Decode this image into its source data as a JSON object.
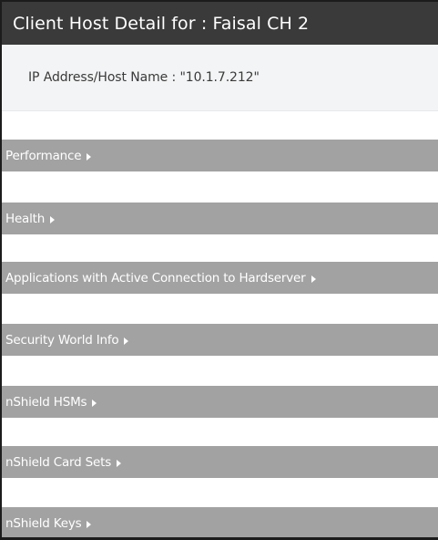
{
  "dialog": {
    "title": "Client Host Detail for : Faisal CH 2"
  },
  "host_info": {
    "ip_text": "IP Address/Host Name : \"10.1.7.212\""
  },
  "sections": [
    {
      "label": "Performance",
      "icon": "caret-right-icon"
    },
    {
      "label": "Health",
      "icon": "caret-right-icon"
    },
    {
      "label": "Applications with Active Connection to Hardserver",
      "icon": "caret-right-icon"
    },
    {
      "label": "Security World Info",
      "icon": "caret-right-icon"
    },
    {
      "label": "nShield HSMs",
      "icon": "caret-right-icon"
    },
    {
      "label": "nShield Card Sets",
      "icon": "caret-right-icon"
    },
    {
      "label": "nShield Keys",
      "icon": "caret-right-icon"
    }
  ],
  "colors": {
    "title_bar": "#3a3a3a",
    "info_panel": "#f3f4f5",
    "section_bar": "#a2a2a2",
    "section_text": "#ffffff"
  }
}
